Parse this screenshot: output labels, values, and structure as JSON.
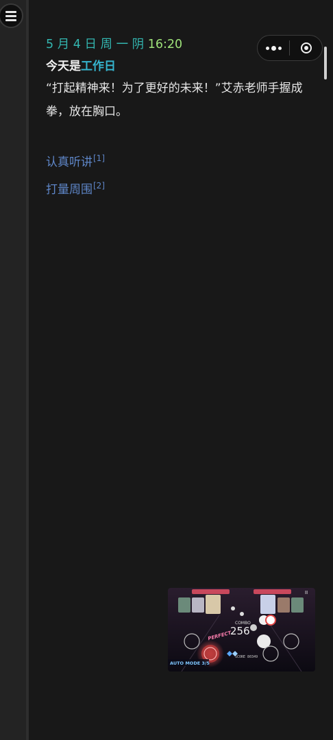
{
  "status": {
    "date": "5 月 4 日 周 一 阴",
    "time": "16:20"
  },
  "today": {
    "prefix": "今天是",
    "day_type": "工作日"
  },
  "narration": "“打起精神来！为了更好的未来！”艾赤老师手握成拳，放在胸口。",
  "choices": [
    {
      "label": "认真听讲",
      "ref": "[1]"
    },
    {
      "label": "打量周围",
      "ref": "[2]"
    }
  ],
  "capsule": {
    "more_icon": "more-dots-icon",
    "close_icon": "target-circle-icon"
  },
  "video": {
    "combo_label": "COMBO",
    "combo_value": "256",
    "judgement": "PERFECT",
    "mode": "AUTO MODE 3/5",
    "score": "SCORE 80349",
    "pause": "II"
  },
  "colors": {
    "status": "#33b6b0",
    "time": "#9ee27a",
    "highlight": "#35b4ce",
    "link": "#5e86c8",
    "background": "#181818"
  }
}
